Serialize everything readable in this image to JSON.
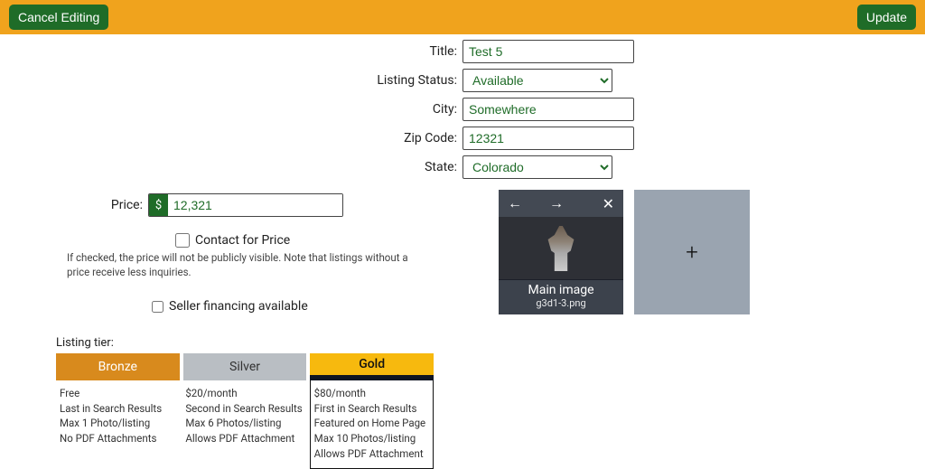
{
  "topbar": {
    "cancel_label": "Cancel Editing",
    "update_label": "Update"
  },
  "form": {
    "title_label": "Title:",
    "title_value": "Test 5",
    "status_label": "Listing Status:",
    "status_value": "Available",
    "city_label": "City:",
    "city_value": "Somewhere",
    "zip_label": "Zip Code:",
    "zip_value": "12321",
    "state_label": "State:",
    "state_value": "Colorado"
  },
  "price": {
    "label": "Price:",
    "currency": "$",
    "value": "12,321",
    "contact_label": "Contact for Price",
    "helper": "If checked, the price will not be publicly visible. Note that listings without a price receive less inquiries.",
    "financing_label": "Seller financing available"
  },
  "images": {
    "main_label": "Main image",
    "filename": "g3d1-3.png",
    "add_label": "+"
  },
  "tiers": {
    "label": "Listing tier:",
    "bronze": {
      "name": "Bronze",
      "lines": [
        "Free",
        "Last in Search Results",
        "Max 1 Photo/listing",
        "No PDF Attachments"
      ]
    },
    "silver": {
      "name": "Silver",
      "lines": [
        "$20/month",
        "Second in Search Results",
        "Max 6 Photos/listing",
        "Allows PDF Attachment"
      ]
    },
    "gold": {
      "name": "Gold",
      "lines": [
        "$80/month",
        "First in Search Results",
        "Featured on Home Page",
        "Max 10 Photos/listing",
        "Allows PDF Attachment"
      ]
    }
  }
}
